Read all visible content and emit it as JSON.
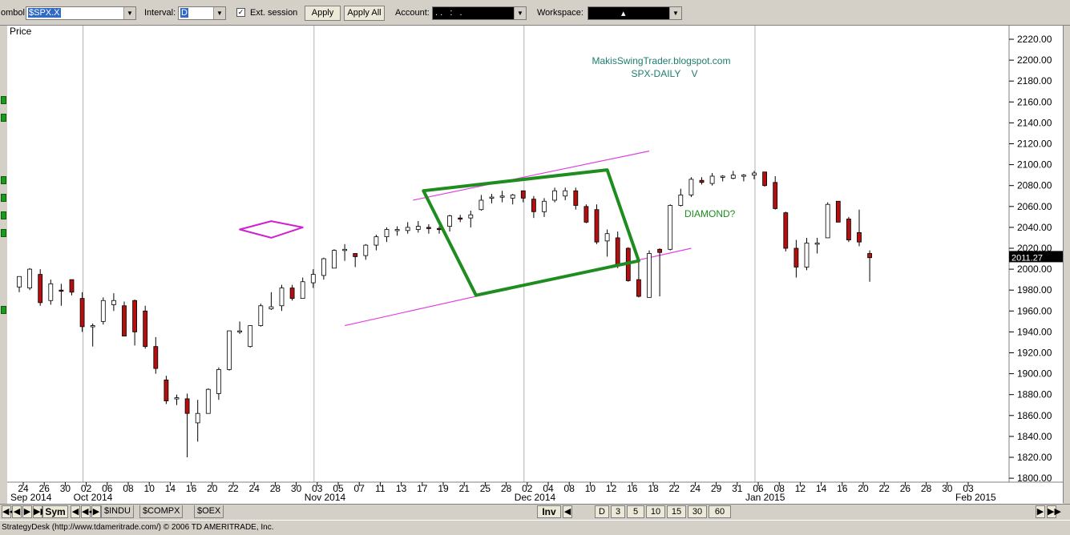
{
  "toolbar": {
    "symbol_label": "ombol:",
    "symbol_value": "$SPX.X",
    "interval_label": "Interval:",
    "interval_value": "D",
    "ext_session_label": "Ext. session",
    "ext_session_checked": true,
    "apply_label": "Apply",
    "apply_all_label": "Apply All",
    "account_label": "Account:",
    "account_value": ". .   :   .",
    "workspace_label": "Workspace:",
    "workspace_value": "▴"
  },
  "bottom_bar": {
    "sym_label": "Sym",
    "tabs": [
      "$INDU",
      "$COMPX",
      "$OEX"
    ],
    "inv_label": "Inv",
    "periods": [
      "D",
      "3",
      "5",
      "10",
      "15",
      "30",
      "60"
    ]
  },
  "status": "StrategyDesk (http://www.tdameritrade.com/) © 2006 TD AMERITRADE, Inc.",
  "colors": {
    "up_candle": "#ffffff",
    "down_candle": "#b30f0f",
    "diamond_small": "#d020d0",
    "diamond_large": "#1e8c1e",
    "channel": "#e040e0",
    "watermark": "#1e7d6e",
    "price_tag_bg": "#000000"
  },
  "chart_data": {
    "type": "candlestick",
    "title": "MakisSwingTrader.blogspot.com",
    "subtitle": "SPX-DAILY    V",
    "ylabel": "Price",
    "ylim": [
      1780,
      2230
    ],
    "y_ticks": [
      1800,
      1820,
      1840,
      1860,
      1880,
      1900,
      1920,
      1940,
      1960,
      1980,
      2000,
      2020,
      2040,
      2060,
      2080,
      2100,
      2120,
      2140,
      2160,
      2180,
      2200,
      2220
    ],
    "last_price": "2011.27",
    "annotation": "DIAMOND?",
    "x_day_labels": [
      "24",
      "26",
      "30",
      "02",
      "06",
      "08",
      "10",
      "14",
      "16",
      "20",
      "22",
      "24",
      "28",
      "30",
      "03",
      "05",
      "07",
      "11",
      "13",
      "17",
      "19",
      "21",
      "25",
      "28",
      "02",
      "04",
      "08",
      "10",
      "12",
      "16",
      "18",
      "22",
      "24",
      "29",
      "31",
      "06",
      "08",
      "12",
      "14",
      "16",
      "20",
      "22",
      "26",
      "28",
      "30",
      "03"
    ],
    "x_month_labels": [
      {
        "label": "Sep 2014",
        "day_index": 0
      },
      {
        "label": "Oct 2014",
        "day_index": 3
      },
      {
        "label": "Nov 2014",
        "day_index": 14
      },
      {
        "label": "Dec 2014",
        "day_index": 24
      },
      {
        "label": "Jan 2015",
        "day_index": 35
      },
      {
        "label": "Feb 2015",
        "day_index": 45
      }
    ],
    "month_separators": [
      3,
      14,
      24,
      35
    ],
    "candles": [
      {
        "o": 1983,
        "h": 1988,
        "l": 1978,
        "c": 1993
      },
      {
        "o": 1982,
        "h": 2001,
        "l": 1980,
        "c": 2000
      },
      {
        "o": 1995,
        "h": 2000,
        "l": 1965,
        "c": 1968
      },
      {
        "o": 1970,
        "h": 1990,
        "l": 1966,
        "c": 1986
      },
      {
        "o": 1980,
        "h": 1986,
        "l": 1965,
        "c": 1979
      },
      {
        "o": 1990,
        "h": 1990,
        "l": 1975,
        "c": 1978
      },
      {
        "o": 1972,
        "h": 1978,
        "l": 1940,
        "c": 1945
      },
      {
        "o": 1946,
        "h": 1948,
        "l": 1926,
        "c": 1946
      },
      {
        "o": 1950,
        "h": 1973,
        "l": 1947,
        "c": 1970
      },
      {
        "o": 1966,
        "h": 1977,
        "l": 1960,
        "c": 1970
      },
      {
        "o": 1965,
        "h": 1969,
        "l": 1936,
        "c": 1936
      },
      {
        "o": 1970,
        "h": 1971,
        "l": 1927,
        "c": 1940
      },
      {
        "o": 1960,
        "h": 1965,
        "l": 1924,
        "c": 1926
      },
      {
        "o": 1926,
        "h": 1935,
        "l": 1900,
        "c": 1905
      },
      {
        "o": 1894,
        "h": 1898,
        "l": 1871,
        "c": 1874
      },
      {
        "o": 1877,
        "h": 1880,
        "l": 1870,
        "c": 1877
      },
      {
        "o": 1876,
        "h": 1881,
        "l": 1820,
        "c": 1862
      },
      {
        "o": 1853,
        "h": 1875,
        "l": 1835,
        "c": 1862
      },
      {
        "o": 1862,
        "h": 1886,
        "l": 1862,
        "c": 1885
      },
      {
        "o": 1881,
        "h": 1906,
        "l": 1875,
        "c": 1904
      },
      {
        "o": 1904,
        "h": 1941,
        "l": 1903,
        "c": 1941
      },
      {
        "o": 1941,
        "h": 1950,
        "l": 1938,
        "c": 1941
      },
      {
        "o": 1926,
        "h": 1945,
        "l": 1925,
        "c": 1946
      },
      {
        "o": 1946,
        "h": 1967,
        "l": 1945,
        "c": 1965
      },
      {
        "o": 1962,
        "h": 1978,
        "l": 1961,
        "c": 1964
      },
      {
        "o": 1965,
        "h": 1985,
        "l": 1960,
        "c": 1982
      },
      {
        "o": 1982,
        "h": 1985,
        "l": 1970,
        "c": 1972
      },
      {
        "o": 1972,
        "h": 1992,
        "l": 1972,
        "c": 1988
      },
      {
        "o": 1987,
        "h": 2000,
        "l": 1982,
        "c": 1995
      },
      {
        "o": 1994,
        "h": 2011,
        "l": 1990,
        "c": 2010
      },
      {
        "o": 2001,
        "h": 2019,
        "l": 2001,
        "c": 2018
      },
      {
        "o": 2019,
        "h": 2024,
        "l": 2008,
        "c": 2019
      },
      {
        "o": 2015,
        "h": 2015,
        "l": 2002,
        "c": 2012
      },
      {
        "o": 2013,
        "h": 2024,
        "l": 2009,
        "c": 2023
      },
      {
        "o": 2023,
        "h": 2033,
        "l": 2018,
        "c": 2031
      },
      {
        "o": 2031,
        "h": 2040,
        "l": 2026,
        "c": 2038
      },
      {
        "o": 2038,
        "h": 2041,
        "l": 2032,
        "c": 2038
      },
      {
        "o": 2037,
        "h": 2045,
        "l": 2034,
        "c": 2040
      },
      {
        "o": 2038,
        "h": 2046,
        "l": 2035,
        "c": 2041
      },
      {
        "o": 2040,
        "h": 2043,
        "l": 2034,
        "c": 2039
      },
      {
        "o": 2039,
        "h": 2041,
        "l": 2034,
        "c": 2038
      },
      {
        "o": 2041,
        "h": 2052,
        "l": 2036,
        "c": 2051
      },
      {
        "o": 2049,
        "h": 2052,
        "l": 2045,
        "c": 2048
      },
      {
        "o": 2049,
        "h": 2056,
        "l": 2040,
        "c": 2052
      },
      {
        "o": 2057,
        "h": 2071,
        "l": 2056,
        "c": 2066
      },
      {
        "o": 2068,
        "h": 2072,
        "l": 2063,
        "c": 2069
      },
      {
        "o": 2070,
        "h": 2075,
        "l": 2064,
        "c": 2070
      },
      {
        "o": 2068,
        "h": 2072,
        "l": 2062,
        "c": 2071
      },
      {
        "o": 2075,
        "h": 2075,
        "l": 2064,
        "c": 2068
      },
      {
        "o": 2067,
        "h": 2070,
        "l": 2049,
        "c": 2055
      },
      {
        "o": 2055,
        "h": 2068,
        "l": 2050,
        "c": 2065
      },
      {
        "o": 2066,
        "h": 2078,
        "l": 2064,
        "c": 2075
      },
      {
        "o": 2070,
        "h": 2078,
        "l": 2066,
        "c": 2075
      },
      {
        "o": 2075,
        "h": 2078,
        "l": 2057,
        "c": 2061
      },
      {
        "o": 2060,
        "h": 2062,
        "l": 2044,
        "c": 2045
      },
      {
        "o": 2057,
        "h": 2062,
        "l": 2024,
        "c": 2026
      },
      {
        "o": 2027,
        "h": 2038,
        "l": 2012,
        "c": 2034
      },
      {
        "o": 2030,
        "h": 2036,
        "l": 2001,
        "c": 2003
      },
      {
        "o": 2020,
        "h": 2021,
        "l": 1988,
        "c": 1989
      },
      {
        "o": 1990,
        "h": 2007,
        "l": 1973,
        "c": 1974
      },
      {
        "o": 1973,
        "h": 2018,
        "l": 1973,
        "c": 2015
      },
      {
        "o": 2019,
        "h": 2020,
        "l": 1974,
        "c": 2016
      },
      {
        "o": 2019,
        "h": 2062,
        "l": 2018,
        "c": 2061
      },
      {
        "o": 2061,
        "h": 2077,
        "l": 2060,
        "c": 2071
      },
      {
        "o": 2071,
        "h": 2088,
        "l": 2069,
        "c": 2086
      },
      {
        "o": 2085,
        "h": 2088,
        "l": 2081,
        "c": 2083
      },
      {
        "o": 2082,
        "h": 2092,
        "l": 2080,
        "c": 2089
      },
      {
        "o": 2088,
        "h": 2090,
        "l": 2084,
        "c": 2089
      },
      {
        "o": 2087,
        "h": 2094,
        "l": 2086,
        "c": 2090
      },
      {
        "o": 2089,
        "h": 2091,
        "l": 2084,
        "c": 2090
      },
      {
        "o": 2090,
        "h": 2094,
        "l": 2086,
        "c": 2092
      },
      {
        "o": 2093,
        "h": 2093,
        "l": 2079,
        "c": 2080
      },
      {
        "o": 2083,
        "h": 2089,
        "l": 2057,
        "c": 2058
      },
      {
        "o": 2054,
        "h": 2055,
        "l": 2017,
        "c": 2020
      },
      {
        "o": 2020,
        "h": 2028,
        "l": 1992,
        "c": 2002
      },
      {
        "o": 2002,
        "h": 2030,
        "l": 1999,
        "c": 2025
      },
      {
        "o": 2025,
        "h": 2030,
        "l": 2015,
        "c": 2025
      },
      {
        "o": 2030,
        "h": 2064,
        "l": 2030,
        "c": 2062
      },
      {
        "o": 2065,
        "h": 2065,
        "l": 2045,
        "c": 2045
      },
      {
        "o": 2048,
        "h": 2050,
        "l": 2026,
        "c": 2028
      },
      {
        "o": 2035,
        "h": 2057,
        "l": 2022,
        "c": 2026
      },
      {
        "o": 2015,
        "h": 2018,
        "l": 1988,
        "c": 2011
      }
    ],
    "overlays": [
      {
        "name": "upper-channel-line",
        "kind": "line",
        "color": "#e040e0",
        "from": [
          37.5,
          2066
        ],
        "to": [
          60,
          2113
        ]
      },
      {
        "name": "lower-channel-line",
        "kind": "line",
        "color": "#e040e0",
        "from": [
          31,
          1946
        ],
        "to": [
          64,
          2020
        ]
      },
      {
        "name": "small-diamond",
        "kind": "polygon",
        "color": "#d020d0",
        "points": [
          [
            21,
            2038
          ],
          [
            24,
            2046
          ],
          [
            27,
            2040
          ],
          [
            24,
            2030
          ]
        ]
      },
      {
        "name": "large-diamond",
        "kind": "polygon",
        "color": "#1e8c1e",
        "points": [
          [
            38.5,
            2075
          ],
          [
            56,
            2095
          ],
          [
            59,
            2008
          ],
          [
            43.5,
            1975
          ]
        ]
      }
    ]
  }
}
